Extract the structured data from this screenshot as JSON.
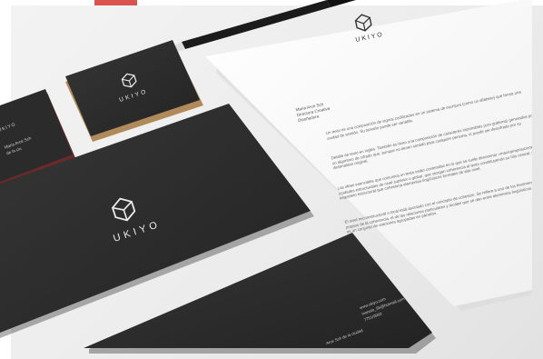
{
  "brand": {
    "name": "UKIYO"
  },
  "business_cards": {
    "front_name": "Maria Arce Sch",
    "front_role": "de la ciu"
  },
  "letter": {
    "recipient_name": "Maria Arce Sch",
    "recipient_title": "Directora Creativa",
    "recipient_org": "Diseñadora",
    "paragraph_1": "Un texto es una composición de signos codificados en un sistema de escritura (como un alfabeto) que forma una unidad de sentido. Su tamaño puede ser variable.",
    "paragraph_2": "Detalle de texto en inglés. También es texto una composición de caracteres imprimibles (con grafema) generados por un algoritmo de cifrado que, aunque no tienen sentido para cualquier persona, sí puede ser descifrado por su destinatario original.",
    "paragraph_3": "Las ideas esenciales que comunica un texto están contenidas en lo que se suele denominar «macroproposiciones», unidades estructurales de nivel superior o global, que otorgan coherencia al texto constituyendo su hilo central, el esqueleto estructural que cohesiona elementos lingüísticos formales de alto nivel.",
    "paragraph_4": "El nivel microestructural o local está asociado con el concepto de cohesión. Se refiere a uno de los fenómenos propios de la coherencia, el de las relaciones particulares y locales que se dan entre elementos lingüísticos. También es un conjunto de oraciones agrupadas en párrafos."
  },
  "envelope_small": {
    "web": "www.ukiyo.com",
    "email": "manolo_55@hotmail.com",
    "phone": "7751/9950",
    "address": "Arce Sch de la ciudad"
  },
  "colors": {
    "card_dark": "#2d2d2d",
    "card_edge": "#b08a5a",
    "burgundy_edge": "#6b2a2a",
    "paper": "#fbfbfb",
    "accent_red": "#d9534f"
  }
}
